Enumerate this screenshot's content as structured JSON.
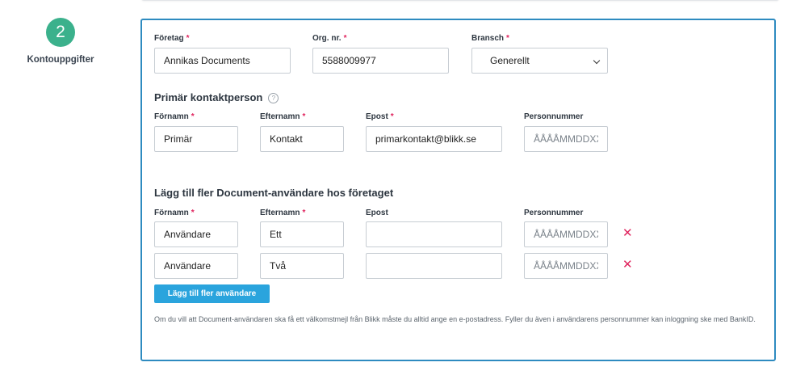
{
  "step": {
    "number": "2",
    "label": "Kontouppgifter"
  },
  "company": {
    "company_label": "Företag",
    "company_value": "Annikas Documents",
    "org_label": "Org. nr.",
    "org_value": "5588009977",
    "industry_label": "Bransch",
    "industry_value": "Generellt"
  },
  "primary": {
    "title": "Primär kontaktperson",
    "help": "?",
    "first_label": "Förnamn",
    "first_value": "Primär",
    "last_label": "Efternamn",
    "last_value": "Kontakt",
    "email_label": "Epost",
    "email_value": "primarkontakt@blikk.se",
    "pnr_label": "Personnummer",
    "pnr_placeholder": "ÅÅÅÅMMDDXXXX"
  },
  "users": {
    "title": "Lägg till fler Document-användare hos företaget",
    "first_label": "Förnamn",
    "last_label": "Efternamn",
    "email_label": "Epost",
    "pnr_label": "Personnummer",
    "rows": [
      {
        "first": "Användare",
        "last": "Ett",
        "email": "",
        "pnr_placeholder": "ÅÅÅÅMMDDXXXX",
        "remove": "✕"
      },
      {
        "first": "Användare",
        "last": "Två",
        "email": "",
        "pnr_placeholder": "ÅÅÅÅMMDDXXXX",
        "remove": "✕"
      }
    ],
    "add_button": "Lägg till fler användare",
    "info": "Om du vill att Document-användaren ska få ett välkomstmejl från Blikk måste du alltid ange en e-postadress. Fyller du även i användarens personnummer kan inloggning ske med BankID."
  },
  "required_marker": "*",
  "colors": {
    "accent": "#2e8bc0",
    "step": "#3bb18c",
    "required": "#e0245e",
    "button": "#2aa4dd"
  }
}
